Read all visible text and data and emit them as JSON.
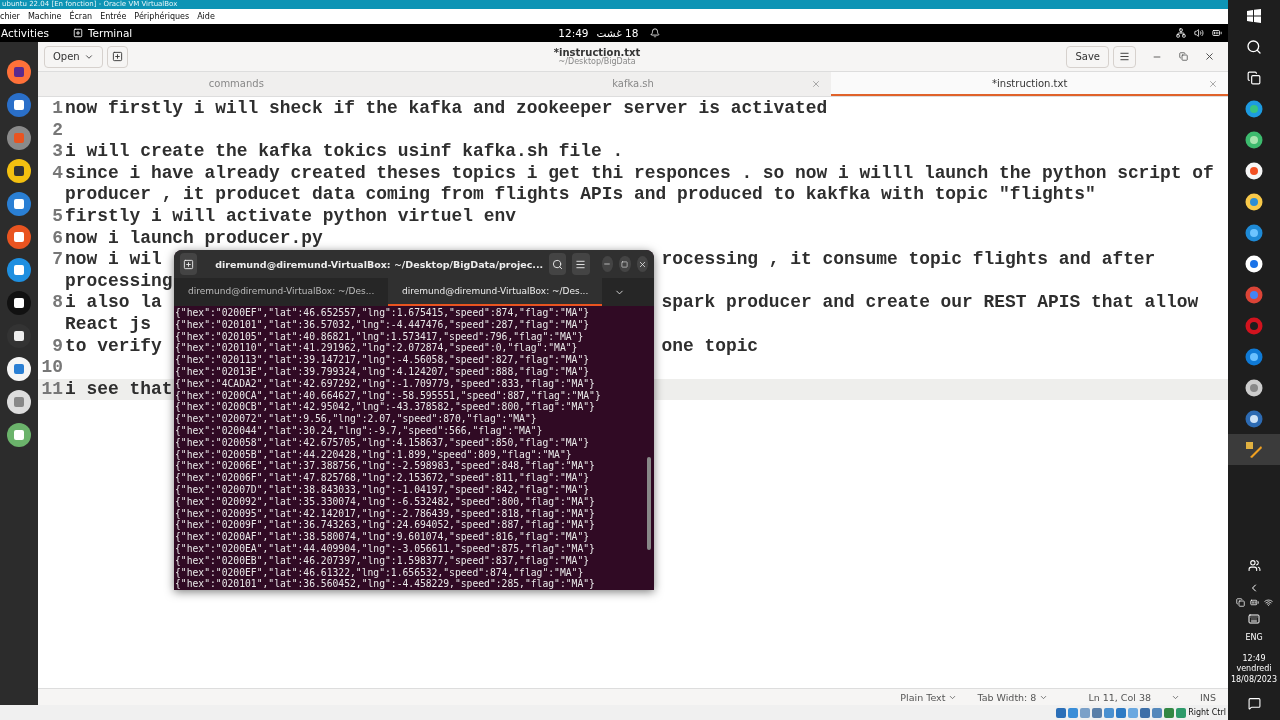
{
  "vm_window": {
    "title": "ubuntu 22.04 [En fonction] - Oracle VM VirtualBox",
    "menu": [
      "chier",
      "Machine",
      "Écran",
      "Entrée",
      "Périphériques",
      "Aide"
    ],
    "host_key": "Right Ctrl"
  },
  "top_bar": {
    "activities": "Activities",
    "app": "Terminal",
    "time": "12:49",
    "date": "18 غشت"
  },
  "editor": {
    "open_button": "Open",
    "title": "*instruction.txt",
    "path": "~/Desktop/BigData",
    "save_button": "Save",
    "tabs": [
      {
        "label": "commands",
        "selected": false
      },
      {
        "label": "kafka.sh",
        "selected": false
      },
      {
        "label": "*instruction.txt",
        "selected": true
      }
    ],
    "lines": [
      {
        "number": "1",
        "current": false,
        "rows": [
          {
            "text": "now firstly i will sheck if the kafka and zookeeper server is activated"
          }
        ]
      },
      {
        "number": "2",
        "current": false,
        "rows": [
          {
            "text": ""
          }
        ]
      },
      {
        "number": "3",
        "current": false,
        "rows": [
          {
            "text": "i will create the kafka tokics usinf kafka.sh file ."
          }
        ]
      },
      {
        "number": "4",
        "current": false,
        "rows": [
          {
            "text": "since i have already created theses topics i get thi responces . so now i willl launch the python script of"
          },
          {
            "text": "producer , it producet data coming from flights APIs and produced to kakfka with topic \"flights\""
          }
        ]
      },
      {
        "number": "5",
        "current": false,
        "rows": [
          {
            "text": "firstly i will activate python virtuel env"
          }
        ]
      },
      {
        "number": "6",
        "current": false,
        "rows": [
          {
            "text": "now i launch producer.py"
          }
        ]
      },
      {
        "number": "7",
        "current": false,
        "rows": [
          {
            "text": "now i wil",
            "tail": "rocessing , it consume topic flights and after"
          },
          {
            "text": "processing"
          }
        ]
      },
      {
        "number": "8",
        "current": false,
        "rows": [
          {
            "text": "i also la",
            "tail": "spark producer and create our REST APIS that allow"
          },
          {
            "text": "React js"
          }
        ]
      },
      {
        "number": "9",
        "current": false,
        "rows": [
          {
            "text": "to verify",
            "tail": "one topic"
          }
        ]
      },
      {
        "number": "10",
        "current": false,
        "rows": [
          {
            "text": ""
          }
        ]
      },
      {
        "number": "11",
        "current": true,
        "rows": [
          {
            "text": "i see that"
          }
        ]
      }
    ],
    "status": {
      "language": "Plain Text",
      "tab_width": "Tab Width: 8",
      "position": "Ln 11, Col 38",
      "mode": "INS"
    }
  },
  "terminal": {
    "title": "diremund@diremund-VirtualBox: ~/Desktop/BigData/projec...",
    "tabs": [
      {
        "label": "diremund@diremund-VirtualBox: ~/Des...",
        "selected": false
      },
      {
        "label": "diremund@diremund-VirtualBox: ~/Des...",
        "selected": true
      }
    ],
    "output": [
      "{\"hex\":\"0200EF\",\"lat\":46.652557,\"lng\":1.675415,\"speed\":874,\"flag\":\"MA\"}",
      "{\"hex\":\"020101\",\"lat\":36.57032,\"lng\":-4.447476,\"speed\":287,\"flag\":\"MA\"}",
      "{\"hex\":\"020105\",\"lat\":40.86821,\"lng\":1.573417,\"speed\":796,\"flag\":\"MA\"}",
      "{\"hex\":\"020110\",\"lat\":41.291962,\"lng\":2.072874,\"speed\":0,\"flag\":\"MA\"}",
      "{\"hex\":\"020113\",\"lat\":39.147217,\"lng\":-4.56058,\"speed\":827,\"flag\":\"MA\"}",
      "{\"hex\":\"02013E\",\"lat\":39.799324,\"lng\":4.124207,\"speed\":888,\"flag\":\"MA\"}",
      "{\"hex\":\"4CADA2\",\"lat\":42.697292,\"lng\":-1.709779,\"speed\":833,\"flag\":\"MA\"}",
      "{\"hex\":\"0200CA\",\"lat\":40.664627,\"lng\":-58.595551,\"speed\":887,\"flag\":\"MA\"}",
      "{\"hex\":\"0200CB\",\"lat\":42.95042,\"lng\":-43.378582,\"speed\":800,\"flag\":\"MA\"}",
      "{\"hex\":\"020072\",\"lat\":9.56,\"lng\":2.07,\"speed\":870,\"flag\":\"MA\"}",
      "{\"hex\":\"020044\",\"lat\":30.24,\"lng\":-9.7,\"speed\":566,\"flag\":\"MA\"}",
      "{\"hex\":\"020058\",\"lat\":42.675705,\"lng\":4.158637,\"speed\":850,\"flag\":\"MA\"}",
      "{\"hex\":\"02005B\",\"lat\":44.220428,\"lng\":1.899,\"speed\":809,\"flag\":\"MA\"}",
      "{\"hex\":\"02006E\",\"lat\":37.388756,\"lng\":-2.598983,\"speed\":848,\"flag\":\"MA\"}",
      "{\"hex\":\"02006F\",\"lat\":47.825768,\"lng\":2.153672,\"speed\":811,\"flag\":\"MA\"}",
      "{\"hex\":\"02007D\",\"lat\":38.843033,\"lng\":-1.04197,\"speed\":842,\"flag\":\"MA\"}",
      "{\"hex\":\"020092\",\"lat\":35.330074,\"lng\":-6.532482,\"speed\":800,\"flag\":\"MA\"}",
      "{\"hex\":\"020095\",\"lat\":42.142017,\"lng\":-2.786439,\"speed\":818,\"flag\":\"MA\"}",
      "{\"hex\":\"02009F\",\"lat\":36.743263,\"lng\":24.694052,\"speed\":887,\"flag\":\"MA\"}",
      "{\"hex\":\"0200AF\",\"lat\":38.580074,\"lng\":9.601074,\"speed\":816,\"flag\":\"MA\"}",
      "{\"hex\":\"0200EA\",\"lat\":44.409904,\"lng\":-3.056611,\"speed\":875,\"flag\":\"MA\"}",
      "{\"hex\":\"0200EB\",\"lat\":46.207397,\"lng\":1.598377,\"speed\":837,\"flag\":\"MA\"}",
      "{\"hex\":\"0200EF\",\"lat\":46.61322,\"lng\":1.656532,\"speed\":874,\"flag\":\"MA\"}",
      "{\"hex\":\"020101\",\"lat\":36.560452,\"lng\":-4.458229,\"speed\":285,\"flag\":\"MA\"}"
    ]
  },
  "taskbar": {
    "language": "ENG",
    "time": "12:49",
    "day": "vendredi",
    "date": "18/08/2023"
  }
}
